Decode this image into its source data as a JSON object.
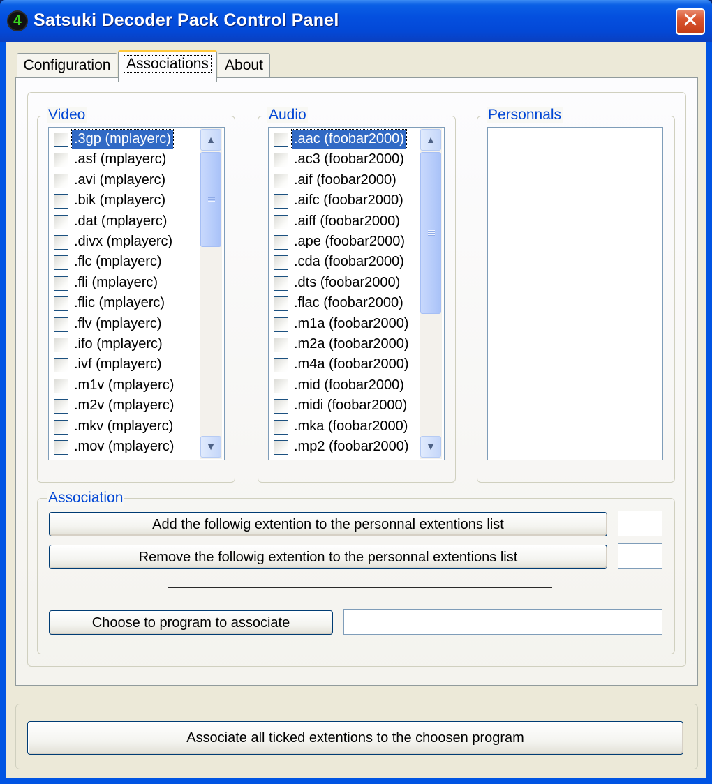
{
  "window": {
    "title": "Satsuki Decoder Pack Control Panel",
    "icon_glyph": "4",
    "close_glyph": "✕"
  },
  "tabs": [
    {
      "label": "Configuration",
      "active": false
    },
    {
      "label": "Associations",
      "active": true
    },
    {
      "label": "About",
      "active": false
    }
  ],
  "video": {
    "label": "Video",
    "items": [
      ".3gp (mplayerc)",
      ".asf (mplayerc)",
      ".avi (mplayerc)",
      ".bik (mplayerc)",
      ".dat (mplayerc)",
      ".divx (mplayerc)",
      ".flc (mplayerc)",
      ".fli (mplayerc)",
      ".flic (mplayerc)",
      ".flv (mplayerc)",
      ".ifo (mplayerc)",
      ".ivf (mplayerc)",
      ".m1v (mplayerc)",
      ".m2v (mplayerc)",
      ".mkv (mplayerc)",
      ".mov (mplayerc)"
    ],
    "selected_index": 0
  },
  "audio": {
    "label": "Audio",
    "items": [
      ".aac (foobar2000)",
      ".ac3 (foobar2000)",
      ".aif (foobar2000)",
      ".aifc (foobar2000)",
      ".aiff (foobar2000)",
      ".ape (foobar2000)",
      ".cda (foobar2000)",
      ".dts (foobar2000)",
      ".flac (foobar2000)",
      ".m1a (foobar2000)",
      ".m2a (foobar2000)",
      ".m4a (foobar2000)",
      ".mid (foobar2000)",
      ".midi (foobar2000)",
      ".mka (foobar2000)",
      ".mp2 (foobar2000)"
    ],
    "selected_index": 0
  },
  "personnals": {
    "label": "Personnals"
  },
  "association": {
    "label": "Association",
    "add_button": "Add the followig extention to the personnal extentions list",
    "add_value": "",
    "remove_button": "Remove the followig extention to the personnal extentions list",
    "remove_value": "",
    "choose_button": "Choose to program to associate",
    "program_value": ""
  },
  "footer": {
    "associate_button": "Associate all ticked extentions to the choosen program"
  },
  "scrollbar": {
    "up_glyph": "▲",
    "down_glyph": "▼"
  }
}
